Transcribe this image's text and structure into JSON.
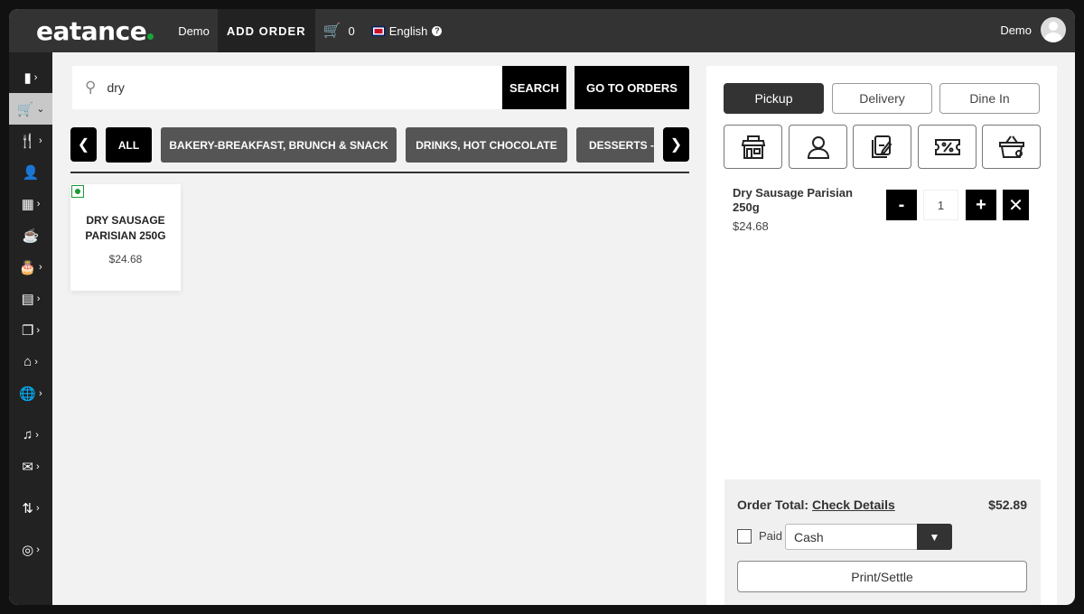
{
  "header": {
    "logo": "eatance",
    "nav": [
      "Demo",
      "ADD ORDER"
    ],
    "cart_count": "0",
    "language": "English",
    "user": "Demo"
  },
  "sidebar": {
    "items": [
      {
        "icon": "bar-chart-icon",
        "glyph": "▮",
        "chev": true
      },
      {
        "icon": "cart-icon",
        "glyph": "🛒",
        "chev": true,
        "active": true
      },
      {
        "icon": "utensils-icon",
        "glyph": "🍴",
        "chev": true
      },
      {
        "icon": "user-icon",
        "glyph": "👤",
        "chev": false
      },
      {
        "icon": "calendar-icon",
        "glyph": "▦",
        "chev": true
      },
      {
        "icon": "cup-icon",
        "glyph": "☕",
        "chev": false
      },
      {
        "icon": "cake-icon",
        "glyph": "🎂",
        "chev": true
      },
      {
        "icon": "table-icon",
        "glyph": "▤",
        "chev": true
      },
      {
        "icon": "copy-icon",
        "glyph": "❐",
        "chev": true
      },
      {
        "icon": "store-icon",
        "glyph": "⌂",
        "chev": true
      },
      {
        "icon": "globe-icon",
        "glyph": "🌐",
        "chev": true
      },
      {
        "icon": "media-icon",
        "glyph": "♫",
        "chev": true
      },
      {
        "icon": "mail-icon",
        "glyph": "✉",
        "chev": true
      },
      {
        "icon": "sort-icon",
        "glyph": "⇅",
        "chev": true
      },
      {
        "icon": "support-icon",
        "glyph": "◎",
        "chev": true
      }
    ]
  },
  "search": {
    "value": "dry",
    "button": "SEARCH",
    "orders_button": "GO TO ORDERS"
  },
  "categories": [
    "ALL",
    "BAKERY-BREAKFAST, BRUNCH & SNACK",
    "DRINKS, HOT CHOCOLATE",
    "DESSERTS - "
  ],
  "products": [
    {
      "name": "DRY SAUSAGE PARISIAN 250G",
      "price": "$24.68"
    }
  ],
  "order": {
    "types": [
      "Pickup",
      "Delivery",
      "Dine In"
    ],
    "active_type": "Pickup",
    "action_icons": [
      "store-icon",
      "customer-icon",
      "note-icon",
      "coupon-icon",
      "basket-icon"
    ],
    "items": [
      {
        "name": "Dry Sausage Parisian 250g",
        "price": "$24.68",
        "qty": "1"
      }
    ],
    "total_label": "Order Total:",
    "details_link": "Check Details",
    "total": "$52.89",
    "paid_label": "Paid",
    "payment_method": "Cash",
    "print_button": "Print/Settle"
  }
}
